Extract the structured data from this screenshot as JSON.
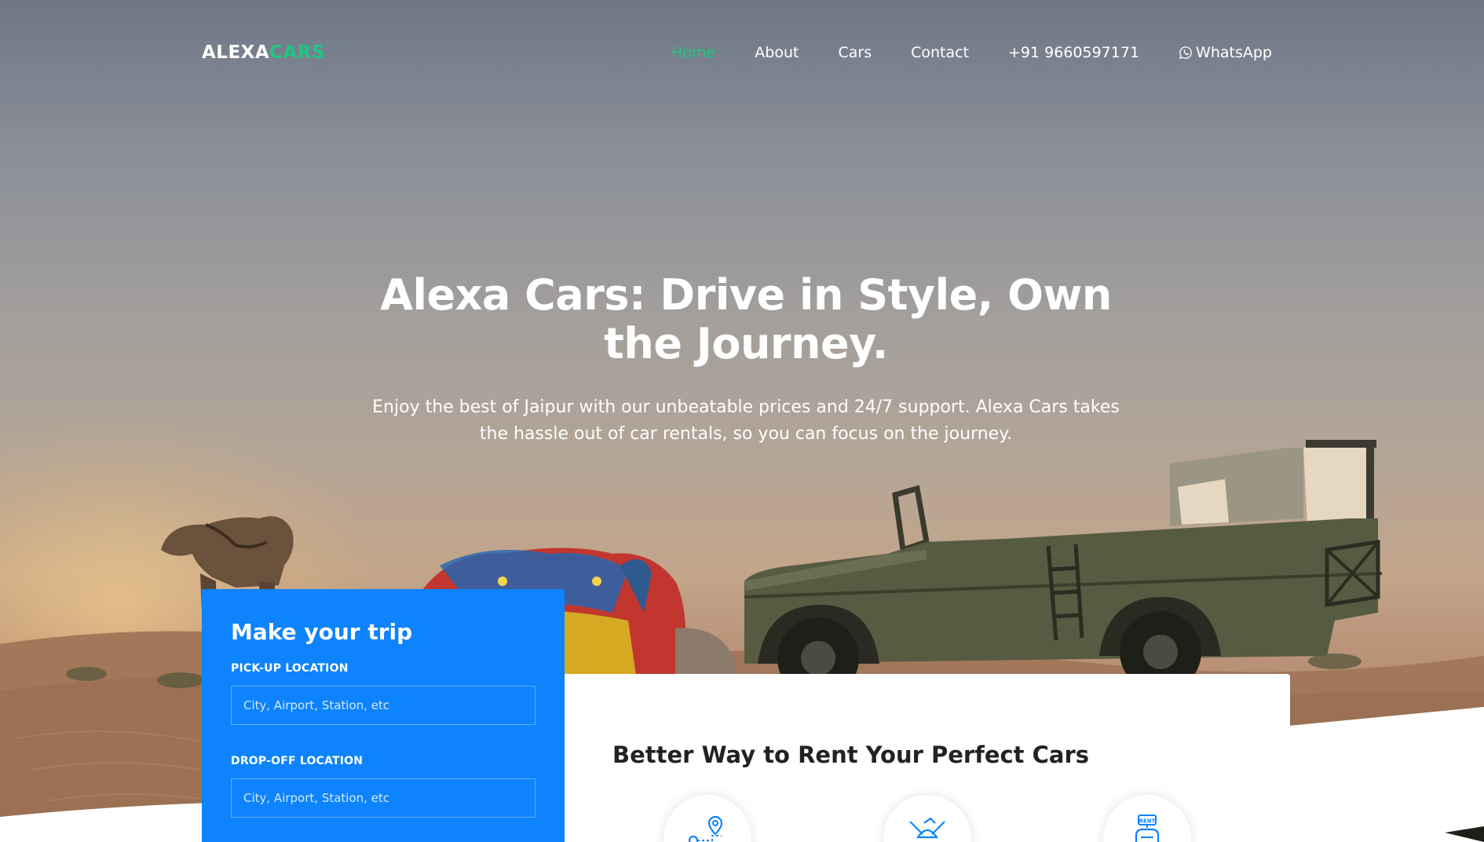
{
  "brand": {
    "logo_part1": "ALEXA",
    "logo_part2": "CARS",
    "accent_color": "#1ec881"
  },
  "nav": {
    "items": [
      {
        "label": "Home",
        "active": true
      },
      {
        "label": "About",
        "active": false
      },
      {
        "label": "Cars",
        "active": false
      },
      {
        "label": "Contact",
        "active": false
      },
      {
        "label": "+91 9660597171",
        "active": false
      }
    ],
    "whatsapp_label": "WhatsApp",
    "whatsapp_icon": "whatsapp-icon"
  },
  "hero": {
    "title": "Alexa Cars: Drive in Style, Own the Journey.",
    "subtitle": "Enjoy the best of Jaipur with our unbeatable prices and 24/7 support. Alexa Cars takes the hassle out of car rentals, so you can focus on the journey."
  },
  "trip_form": {
    "title": "Make your trip",
    "pickup_label": "PICK-UP LOCATION",
    "pickup_placeholder": "City, Airport, Station, etc",
    "dropoff_label": "DROP-OFF LOCATION",
    "dropoff_placeholder": "City, Airport, Station, etc",
    "background_color": "#0d83fd"
  },
  "services": {
    "title": "Better Way to Rent Your Perfect Cars",
    "icons": [
      "route-pin-icon",
      "handshake-car-icon",
      "rent-car-icon"
    ]
  }
}
